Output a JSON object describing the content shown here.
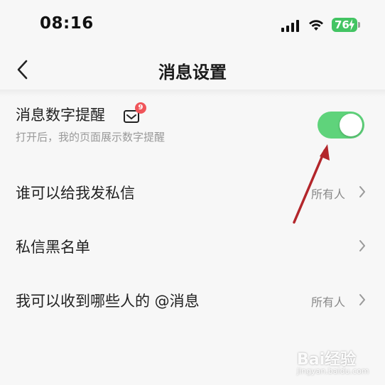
{
  "status_bar": {
    "time": "08:16",
    "battery": "76",
    "signal_icon": "cellular-signal-icon",
    "wifi_icon": "wifi-icon",
    "battery_icon": "battery-charging-icon"
  },
  "nav": {
    "back_icon": "chevron-left-icon",
    "title": "消息设置"
  },
  "settings": {
    "number_reminder": {
      "label": "消息数字提醒",
      "subtitle": "打开后，我的页面展示数字提醒",
      "icon": "mail-icon",
      "badge": "9",
      "enabled": true
    },
    "who_can_dm": {
      "label": "谁可以给我发私信",
      "value": "所有人"
    },
    "dm_blacklist": {
      "label": "私信黑名单"
    },
    "mention_from": {
      "label": "我可以收到哪些人的 @消息",
      "value": "所有人"
    }
  },
  "colors": {
    "toggle_on": "#5fd37b",
    "badge": "#f0555a",
    "battery": "#43c463",
    "annotation_arrow": "#b3262b"
  },
  "watermark": {
    "text": "Bai经验",
    "sub": "jingyan.baidu.com"
  }
}
